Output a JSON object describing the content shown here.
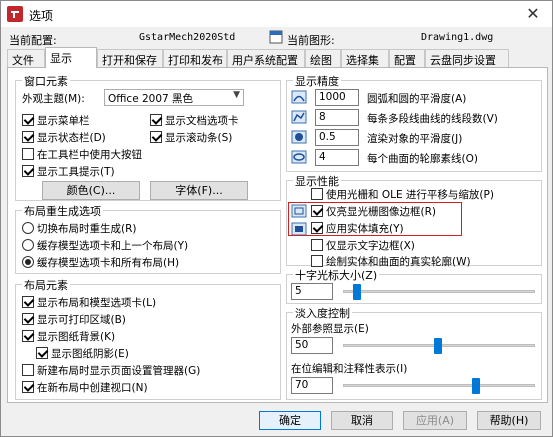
{
  "window": {
    "title": "选项",
    "close": "✕"
  },
  "header": {
    "config_label": "当前配置:",
    "config_value": "GstarMech2020Std",
    "drawing_label": "当前图形:",
    "drawing_value": "Drawing1.dwg"
  },
  "tabs": [
    {
      "label": "文件"
    },
    {
      "label": "显示"
    },
    {
      "label": "打开和保存"
    },
    {
      "label": "打印和发布"
    },
    {
      "label": "用户系统配置"
    },
    {
      "label": "绘图"
    },
    {
      "label": "选择集"
    },
    {
      "label": "配置"
    },
    {
      "label": "云盘同步设置"
    }
  ],
  "active_tab": "显示",
  "window_elements": {
    "title": "窗口元素",
    "theme_label": "外观主题(M):",
    "theme_value": "Office 2007 黑色",
    "checks": [
      {
        "label": "显示菜单栏",
        "checked": true
      },
      {
        "label": "显示文档选项卡",
        "checked": true
      },
      {
        "label": "显示状态栏(D)",
        "checked": true
      },
      {
        "label": "显示滚动条(S)",
        "checked": true
      },
      {
        "label": "在工具栏中使用大按钮",
        "checked": false
      },
      {
        "label": "显示工具提示(T)",
        "checked": true
      }
    ],
    "color_button": "颜色(C)...",
    "font_button": "字体(F)..."
  },
  "layout_regen": {
    "title": "布局重生成选项",
    "options": [
      {
        "label": "切换布局时重生成(R)",
        "selected": false
      },
      {
        "label": "缓存模型选项卡和上一个布局(Y)",
        "selected": false
      },
      {
        "label": "缓存模型选项卡和所有布局(H)",
        "selected": true
      }
    ]
  },
  "layout_elements": {
    "title": "布局元素",
    "checks": [
      {
        "label": "显示布局和模型选项卡(L)",
        "checked": true
      },
      {
        "label": "显示可打印区域(B)",
        "checked": true
      },
      {
        "label": "显示图纸背景(K)",
        "checked": true
      },
      {
        "label": "显示图纸阴影(E)",
        "checked": true
      },
      {
        "label": "新建布局时显示页面设置管理器(G)",
        "checked": false
      },
      {
        "label": "在新布局中创建视口(N)",
        "checked": true
      }
    ]
  },
  "display_precision": {
    "title": "显示精度",
    "rows": [
      {
        "value": "1000",
        "label": "圆弧和圆的平滑度(A)"
      },
      {
        "value": "8",
        "label": "每条多段线曲线的线段数(V)"
      },
      {
        "value": "0.5",
        "label": "渲染对象的平滑度(J)"
      },
      {
        "value": "4",
        "label": "每个曲面的轮廓素线(O)"
      }
    ]
  },
  "display_performance": {
    "title": "显示性能",
    "checks": [
      {
        "label": "使用光栅和 OLE 进行平移与缩放(P)",
        "checked": false
      },
      {
        "label": "仅亮显光栅图像边框(R)",
        "checked": true
      },
      {
        "label": "应用实体填充(Y)",
        "checked": true
      },
      {
        "label": "仅显示文字边框(X)",
        "checked": false
      },
      {
        "label": "绘制实体和曲面的真实轮廓(W)",
        "checked": false
      }
    ]
  },
  "crosshair": {
    "title": "十字光标大小(Z)",
    "value": "5",
    "level": 5
  },
  "fade_control": {
    "title": "淡入度控制",
    "xref_label": "外部参照显示(E)",
    "xref_value": "50",
    "xref_level": 50,
    "inplace_label": "在位编辑和注释性表示(I)",
    "inplace_value": "70",
    "inplace_level": 70
  },
  "footer": {
    "ok": "确定",
    "cancel": "取消",
    "apply": "应用(A)",
    "help": "帮助(H)"
  },
  "colors": {
    "accent": "#0078d7",
    "highlight_box": "#d32020"
  }
}
